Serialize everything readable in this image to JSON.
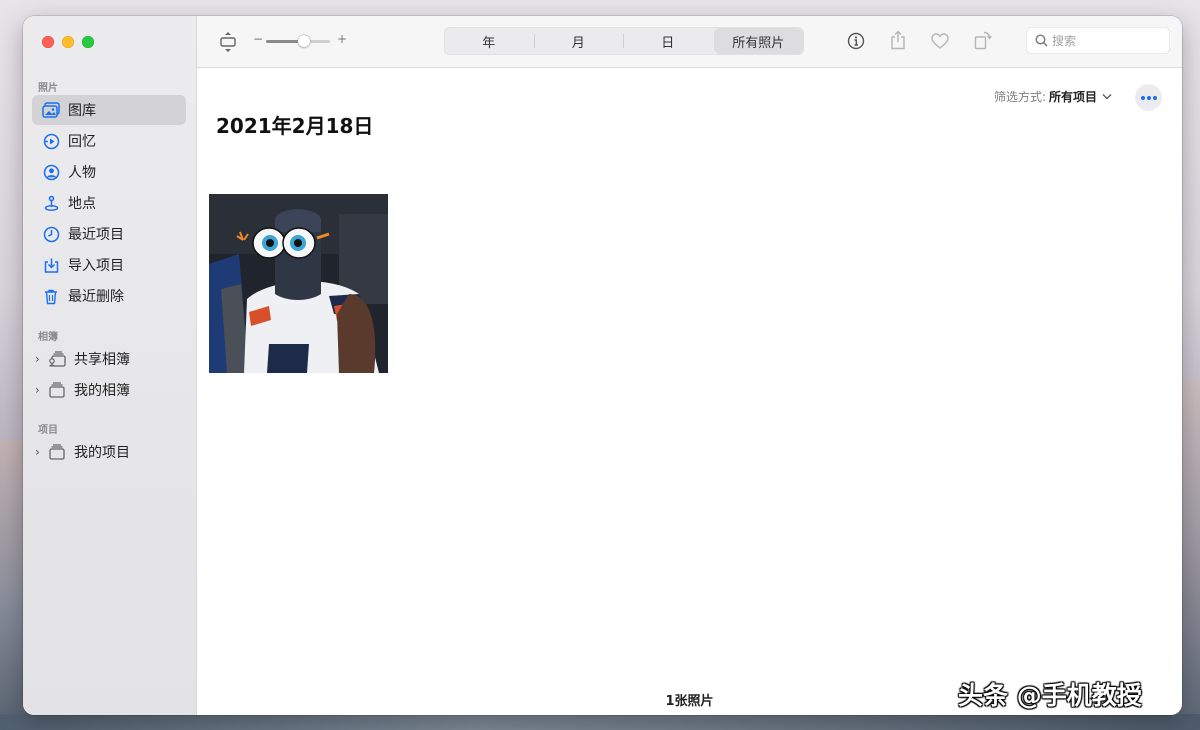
{
  "sidebar": {
    "sections": {
      "photos": "照片",
      "albums": "相簿",
      "projects": "项目"
    },
    "items": [
      {
        "label": "图库",
        "icon": "library-icon",
        "active": true
      },
      {
        "label": "回忆",
        "icon": "memories-icon"
      },
      {
        "label": "人物",
        "icon": "people-icon"
      },
      {
        "label": "地点",
        "icon": "places-icon"
      },
      {
        "label": "最近项目",
        "icon": "recent-icon"
      },
      {
        "label": "导入项目",
        "icon": "import-icon"
      },
      {
        "label": "最近删除",
        "icon": "trash-icon"
      }
    ],
    "album_items": [
      {
        "label": "共享相簿",
        "icon": "shared-album-icon"
      },
      {
        "label": "我的相簿",
        "icon": "album-stack-icon"
      }
    ],
    "project_items": [
      {
        "label": "我的项目",
        "icon": "project-stack-icon"
      }
    ]
  },
  "toolbar": {
    "zoom_minus": "−",
    "zoom_plus": "+",
    "zoom_level": 0.6,
    "segments": [
      "年",
      "月",
      "日",
      "所有照片"
    ],
    "selected_segment": "所有照片",
    "search_placeholder": "搜索"
  },
  "main": {
    "date_title": "2021年2月18日",
    "filter_label": "筛选方式:",
    "filter_value": "所有项目",
    "photo_count": "1张照片"
  },
  "watermark": "头条 @手机教授",
  "colors": {
    "accent": "#1b6ff2",
    "close": "#fe5f57",
    "minimize": "#febc2e",
    "maximize": "#28c840"
  }
}
